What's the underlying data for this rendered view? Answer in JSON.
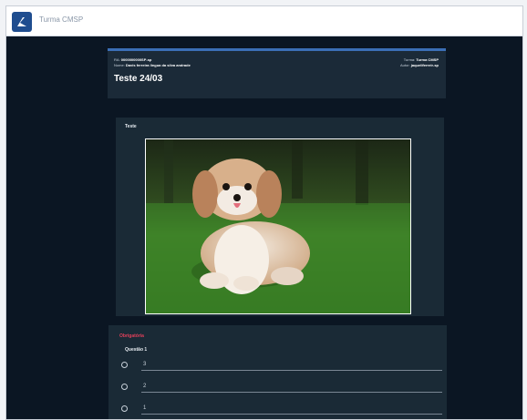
{
  "app": {
    "title": "Turma CMSP"
  },
  "header": {
    "left_meta": [
      {
        "label": "RA:",
        "value": "0000000000SP-sp"
      },
      {
        "label": "Nome:",
        "value": "Davis ferreira lingua da silva andrade"
      }
    ],
    "right_meta": [
      {
        "label": "Turma:",
        "value": "Turma CMSP"
      },
      {
        "label": "Autor:",
        "value": "jaqueliferreir-sp"
      }
    ],
    "title": "Teste 24/03"
  },
  "content": {
    "label": "Teste",
    "image_icon": "puppy-photo"
  },
  "question": {
    "section_label": "Obrigatória",
    "title": "Questão 1",
    "options": [
      "3",
      "2",
      "1"
    ]
  },
  "colors": {
    "background": "#0b1623",
    "card": "#1a2a36",
    "accent": "#3b6fb6",
    "required": "#e0405a"
  }
}
